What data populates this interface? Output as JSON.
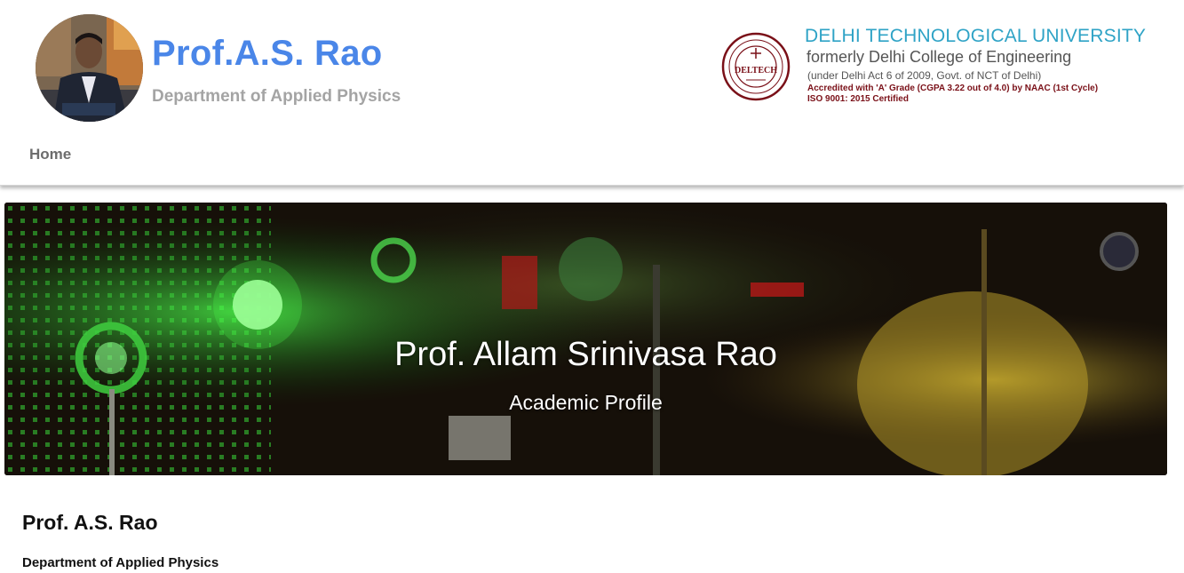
{
  "header": {
    "title": "Prof.A.S. Rao",
    "subtitle": "Department of Applied Physics",
    "title_color": "#4a86e8",
    "subtitle_color": "#a4a4a4"
  },
  "university": {
    "name": "DELHI TECHNOLOGICAL UNIVERSITY",
    "former_name": "formerly Delhi College of Engineering",
    "act": "(under Delhi Act 6 of 2009, Govt. of NCT of Delhi)",
    "accreditation": "Accredited with 'A' Grade (CGPA 3.22 out of 4.0) by NAAC (1st Cycle)",
    "iso": "ISO 9001: 2015 Certified",
    "seal_text": "DELTECH",
    "name_color": "#2fa3c6",
    "accent_color": "#7a1018"
  },
  "nav": {
    "items": [
      {
        "label": "Home"
      }
    ]
  },
  "hero": {
    "title": "Prof. Allam Srinivasa Rao",
    "subtitle": "Academic Profile"
  },
  "profile": {
    "name": "Prof. A.S. Rao",
    "department": "Department of Applied Physics"
  }
}
